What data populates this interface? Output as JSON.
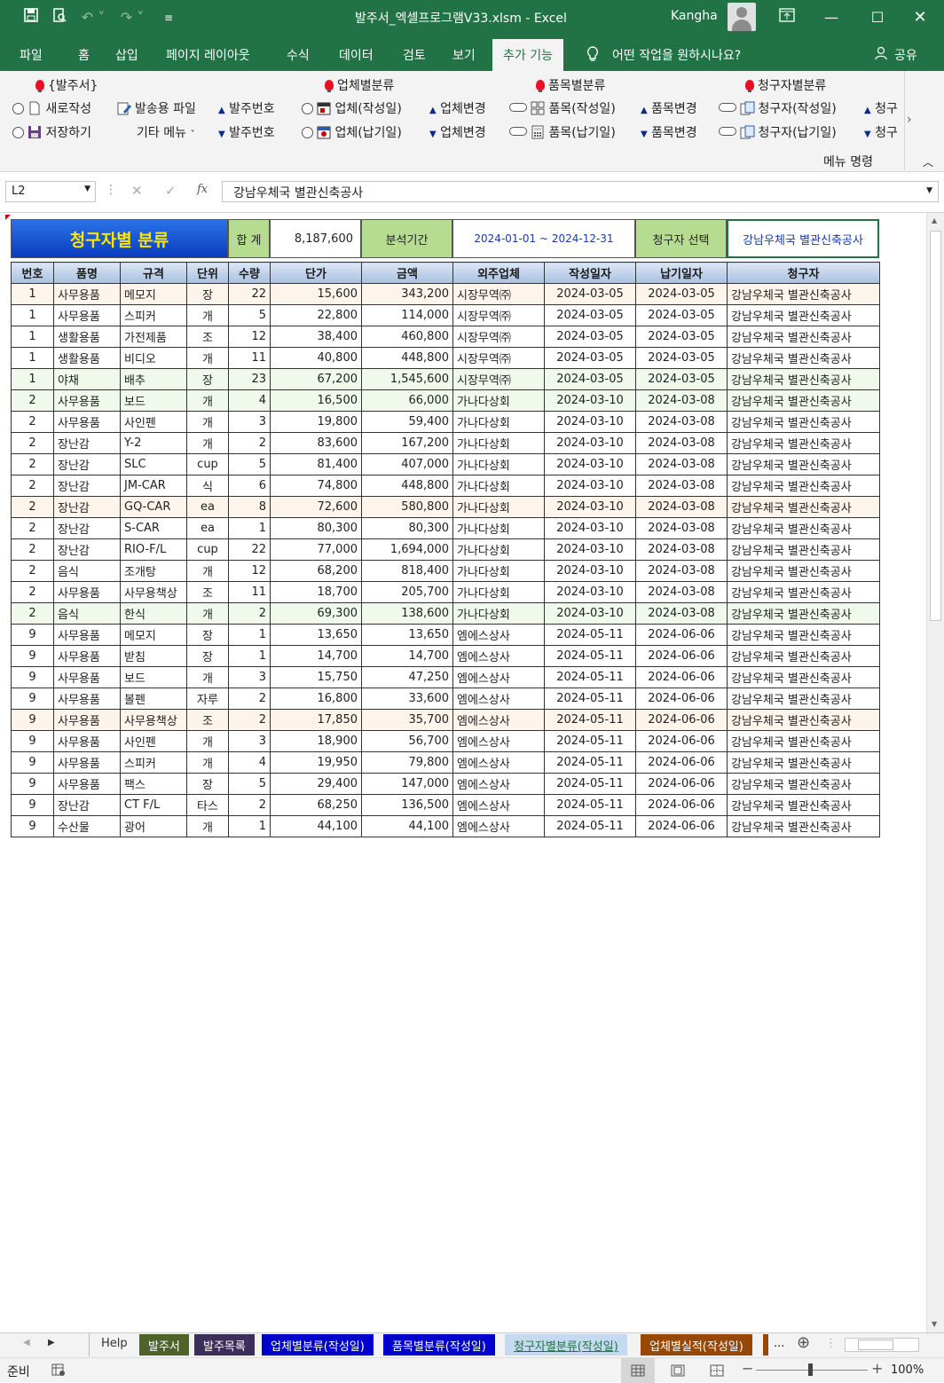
{
  "window": {
    "title": "발주서_엑셀프로그램V33.xlsm  -  Excel",
    "user": "Kangha"
  },
  "menu": {
    "tabs": [
      "파일",
      "홈",
      "삽입",
      "페이지 레이아웃",
      "수식",
      "데이터",
      "검토",
      "보기",
      "추가 기능"
    ],
    "active": "추가 기능",
    "tell_me": "어떤 작업을 원하시나요?",
    "share": "공유"
  },
  "ribbon": {
    "g1_title": "{발주서}",
    "g1_new": "새로작성",
    "g1_save": "저장하기",
    "g1_sendfile": "발송용 파일",
    "g1_other": "기타 메뉴",
    "g1_orderno_up": "발주번호",
    "g1_orderno_dn": "발주번호",
    "g2_title": "업체별분류",
    "g2_a": "업체(작성일)",
    "g2_b": "업체(납기일)",
    "g2_change_up": "업체변경",
    "g2_change_dn": "업체변경",
    "g3_title": "품목별분류",
    "g3_a": "품목(작성일)",
    "g3_b": "품목(납기일)",
    "g3_change_up": "품목변경",
    "g3_change_dn": "품목변경",
    "g4_title": "청구자별분류",
    "g4_a": "청구자(작성일)",
    "g4_b": "청구자(납기일)",
    "g4_change_up": "청구",
    "g4_change_dn": "청구",
    "group_label": "메뉴 명령"
  },
  "formula_bar": {
    "name_box": "L2",
    "content": "강남우체국 별관신축공사"
  },
  "sheet": {
    "banner_title": "청구자별 분류",
    "sum_label": "합 계",
    "sum_value": "8,187,600",
    "period_label": "분석기간",
    "period_value": "2024-01-01  ~  2024-12-31",
    "requester_label": "청구자 선택",
    "requester_value": "강남우체국 별관신축공사",
    "columns": [
      "번호",
      "품명",
      "규격",
      "단위",
      "수량",
      "단가",
      "금액",
      "외주업체",
      "작성일자",
      "납기일자",
      "청구자"
    ],
    "rows": [
      [
        "1",
        "사무용품",
        "메모지",
        "장",
        "22",
        "15,600",
        "343,200",
        "시장무역㈜",
        "2024-03-05",
        "2024-03-05",
        "강남우체국 별관신축공사"
      ],
      [
        "1",
        "사무용품",
        "스피커",
        "개",
        "5",
        "22,800",
        "114,000",
        "시장무역㈜",
        "2024-03-05",
        "2024-03-05",
        "강남우체국 별관신축공사"
      ],
      [
        "1",
        "생활용품",
        "가전제품",
        "조",
        "12",
        "38,400",
        "460,800",
        "시장무역㈜",
        "2024-03-05",
        "2024-03-05",
        "강남우체국 별관신축공사"
      ],
      [
        "1",
        "생활용품",
        "비디오",
        "개",
        "11",
        "40,800",
        "448,800",
        "시장무역㈜",
        "2024-03-05",
        "2024-03-05",
        "강남우체국 별관신축공사"
      ],
      [
        "1",
        "야채",
        "배추",
        "장",
        "23",
        "67,200",
        "1,545,600",
        "시장무역㈜",
        "2024-03-05",
        "2024-03-05",
        "강남우체국 별관신축공사"
      ],
      [
        "2",
        "사무용품",
        "보드",
        "개",
        "4",
        "16,500",
        "66,000",
        "가나다상회",
        "2024-03-10",
        "2024-03-08",
        "강남우체국 별관신축공사"
      ],
      [
        "2",
        "사무용품",
        "사인펜",
        "개",
        "3",
        "19,800",
        "59,400",
        "가나다상회",
        "2024-03-10",
        "2024-03-08",
        "강남우체국 별관신축공사"
      ],
      [
        "2",
        "장난감",
        "Y-2",
        "개",
        "2",
        "83,600",
        "167,200",
        "가나다상회",
        "2024-03-10",
        "2024-03-08",
        "강남우체국 별관신축공사"
      ],
      [
        "2",
        "장난감",
        "SLC",
        "cup",
        "5",
        "81,400",
        "407,000",
        "가나다상회",
        "2024-03-10",
        "2024-03-08",
        "강남우체국 별관신축공사"
      ],
      [
        "2",
        "장난감",
        "JM-CAR",
        "식",
        "6",
        "74,800",
        "448,800",
        "가나다상회",
        "2024-03-10",
        "2024-03-08",
        "강남우체국 별관신축공사"
      ],
      [
        "2",
        "장난감",
        "GQ-CAR",
        "ea",
        "8",
        "72,600",
        "580,800",
        "가나다상회",
        "2024-03-10",
        "2024-03-08",
        "강남우체국 별관신축공사"
      ],
      [
        "2",
        "장난감",
        "S-CAR",
        "ea",
        "1",
        "80,300",
        "80,300",
        "가나다상회",
        "2024-03-10",
        "2024-03-08",
        "강남우체국 별관신축공사"
      ],
      [
        "2",
        "장난감",
        "RIO-F/L",
        "cup",
        "22",
        "77,000",
        "1,694,000",
        "가나다상회",
        "2024-03-10",
        "2024-03-08",
        "강남우체국 별관신축공사"
      ],
      [
        "2",
        "음식",
        "조개탕",
        "개",
        "12",
        "68,200",
        "818,400",
        "가나다상회",
        "2024-03-10",
        "2024-03-08",
        "강남우체국 별관신축공사"
      ],
      [
        "2",
        "사무용품",
        "사무용책상",
        "조",
        "11",
        "18,700",
        "205,700",
        "가나다상회",
        "2024-03-10",
        "2024-03-08",
        "강남우체국 별관신축공사"
      ],
      [
        "2",
        "음식",
        "한식",
        "개",
        "2",
        "69,300",
        "138,600",
        "가나다상회",
        "2024-03-10",
        "2024-03-08",
        "강남우체국 별관신축공사"
      ],
      [
        "9",
        "사무용품",
        "메모지",
        "장",
        "1",
        "13,650",
        "13,650",
        "엠에스상사",
        "2024-05-11",
        "2024-06-06",
        "강남우체국 별관신축공사"
      ],
      [
        "9",
        "사무용품",
        "받침",
        "장",
        "1",
        "14,700",
        "14,700",
        "엠에스상사",
        "2024-05-11",
        "2024-06-06",
        "강남우체국 별관신축공사"
      ],
      [
        "9",
        "사무용품",
        "보드",
        "개",
        "3",
        "15,750",
        "47,250",
        "엠에스상사",
        "2024-05-11",
        "2024-06-06",
        "강남우체국 별관신축공사"
      ],
      [
        "9",
        "사무용품",
        "볼펜",
        "자루",
        "2",
        "16,800",
        "33,600",
        "엠에스상사",
        "2024-05-11",
        "2024-06-06",
        "강남우체국 별관신축공사"
      ],
      [
        "9",
        "사무용품",
        "사무용책상",
        "조",
        "2",
        "17,850",
        "35,700",
        "엠에스상사",
        "2024-05-11",
        "2024-06-06",
        "강남우체국 별관신축공사"
      ],
      [
        "9",
        "사무용품",
        "사인펜",
        "개",
        "3",
        "18,900",
        "56,700",
        "엠에스상사",
        "2024-05-11",
        "2024-06-06",
        "강남우체국 별관신축공사"
      ],
      [
        "9",
        "사무용품",
        "스피커",
        "개",
        "4",
        "19,950",
        "79,800",
        "엠에스상사",
        "2024-05-11",
        "2024-06-06",
        "강남우체국 별관신축공사"
      ],
      [
        "9",
        "사무용품",
        "팩스",
        "장",
        "5",
        "29,400",
        "147,000",
        "엠에스상사",
        "2024-05-11",
        "2024-06-06",
        "강남우체국 별관신축공사"
      ],
      [
        "9",
        "장난감",
        "CT F/L",
        "타스",
        "2",
        "68,250",
        "136,500",
        "엠에스상사",
        "2024-05-11",
        "2024-06-06",
        "강남우체국 별관신축공사"
      ],
      [
        "9",
        "수산물",
        "광어",
        "개",
        "1",
        "44,100",
        "44,100",
        "엠에스상사",
        "2024-05-11",
        "2024-06-06",
        "강남우체국 별관신축공사"
      ]
    ]
  },
  "sheet_tabs": {
    "help": "Help",
    "tabs": [
      {
        "label": "발주서",
        "color": "#4f6228"
      },
      {
        "label": "발주목록",
        "color": "#3b2e5a"
      },
      {
        "label": "업체별분류(작성일)",
        "color": "#0000cc"
      },
      {
        "label": "품목별분류(작성일)",
        "color": "#0000cc"
      },
      {
        "label": "청구자별분류(작성일)",
        "color": "#c5d9f1"
      },
      {
        "label": "업체별실적(작성일)",
        "color": "#974806"
      }
    ],
    "more": "..."
  },
  "status": {
    "ready": "준비",
    "zoom": "100%"
  }
}
